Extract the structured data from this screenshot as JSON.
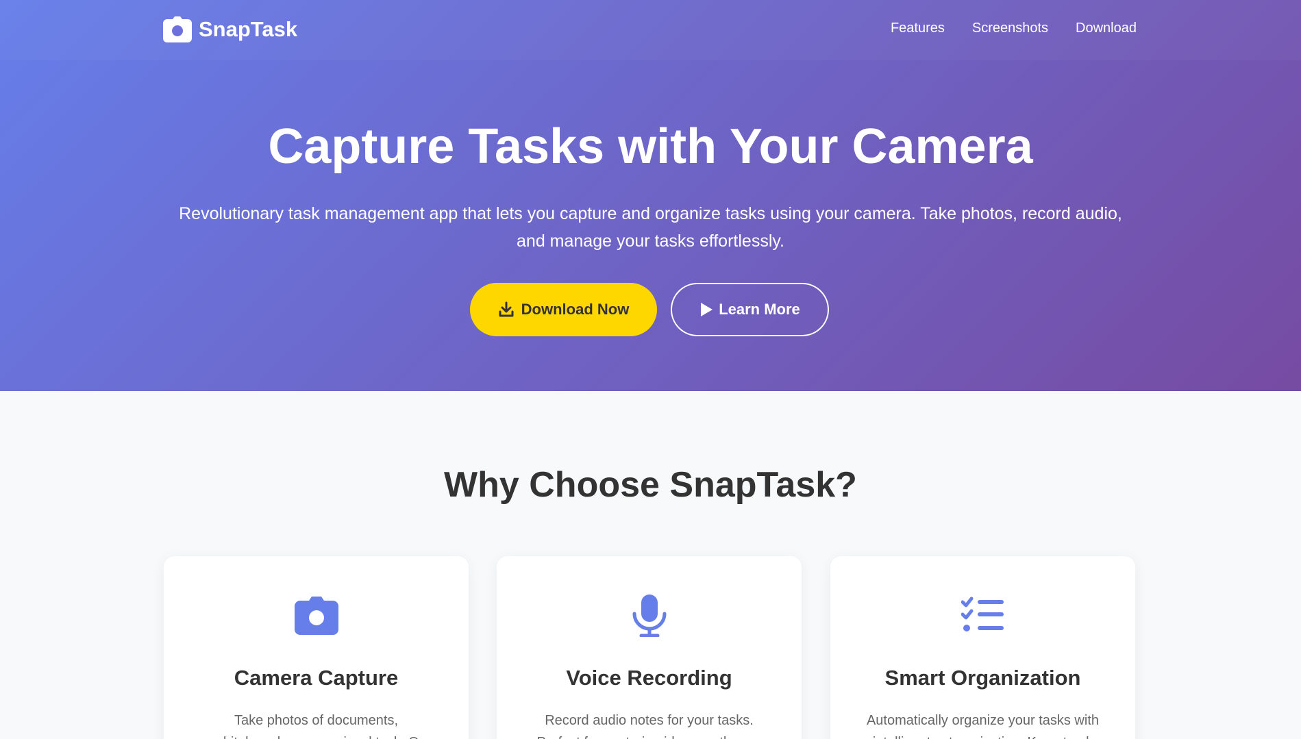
{
  "nav": {
    "brand": "SnapTask",
    "links": [
      "Features",
      "Screenshots",
      "Download"
    ]
  },
  "hero": {
    "title": "Capture Tasks with Your Camera",
    "subtitle": "Revolutionary task management app that lets you capture and organize tasks using your camera. Take photos, record audio, and manage your tasks effortlessly.",
    "primary_button": "Download Now",
    "secondary_button": "Learn More"
  },
  "features": {
    "title": "Why Choose SnapTask?",
    "cards": [
      {
        "icon": "camera-icon",
        "title": "Camera Capture",
        "desc": "Take photos of documents, whiteboards, or any visual task. O"
      },
      {
        "icon": "microphone-icon",
        "title": "Voice Recording",
        "desc": "Record audio notes for your tasks. Perfect for capturing ideas on the go."
      },
      {
        "icon": "task-list-icon",
        "title": "Smart Organization",
        "desc": "Automatically organize your tasks with intelligent categorization. Keep track"
      }
    ]
  },
  "colors": {
    "gradient_start": "#667eea",
    "gradient_end": "#764ba2",
    "accent_yellow": "#ffd700",
    "icon_blue": "#667eea"
  }
}
